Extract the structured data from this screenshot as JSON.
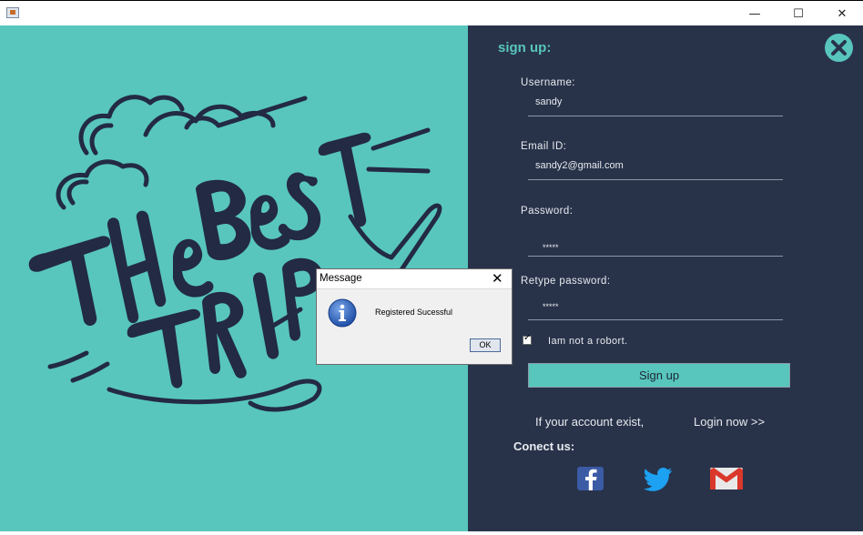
{
  "window": {
    "minimize_label": "—",
    "maximize_label": "☐",
    "close_label": "✕"
  },
  "logo": {
    "text": "The Best Trip"
  },
  "signup": {
    "heading": "sign up:",
    "username_label": "Username:",
    "username_value": "sandy",
    "email_label": "Email ID:",
    "email_value": "sandy2@gmail.com",
    "password_label": "Password:",
    "password_value": "*****",
    "retype_label": "Retype password:",
    "retype_value": "*****",
    "robot_label": "Iam not  a robort.",
    "robot_checked": true,
    "signup_button": "Sign up",
    "account_exist_text": "If your account exist,",
    "login_link": "Login now >>",
    "connect_label": "Conect us:"
  },
  "social": {
    "facebook_icon": "facebook-icon",
    "twitter_icon": "twitter-icon",
    "gmail_icon": "gmail-icon"
  },
  "dialog": {
    "title": "Message",
    "close_label": "✕",
    "message": "Registered Sucessful",
    "ok_button": "OK",
    "icon": "info-icon"
  },
  "colors": {
    "teal": "#58c6bd",
    "navy": "#28334a",
    "ink": "#232a43"
  }
}
